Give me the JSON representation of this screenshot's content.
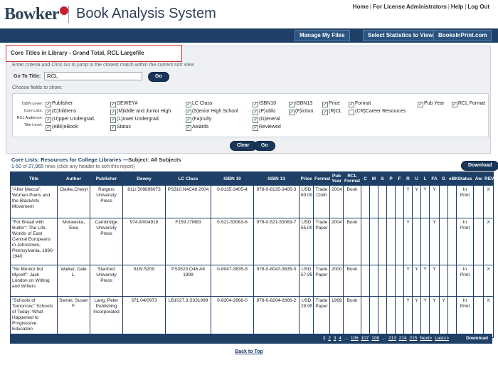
{
  "header": {
    "logo_text": "Bowker",
    "app_title": "Book Analysis System",
    "links": [
      "Home",
      "For License Administrators",
      "Help",
      "Log Out"
    ]
  },
  "nav": {
    "buttons": [
      "Manage My Files",
      "Select Statistics to View",
      "BooksInPrint.com"
    ]
  },
  "panel": {
    "title": "Core Titles in Library - Grand Total, RCL Largefile",
    "hint": "Enter criteria and Click Go to jump to the closest match within the current sort view",
    "goto_label": "Go To Title:",
    "goto_value": "RCL",
    "go_label": "Go",
    "choose_label": "Choose fields to show:",
    "clear_label": "Clear",
    "go2_label": "Go"
  },
  "fields": {
    "row_labels": [
      "ISBN Level:",
      "Core Lists:",
      "RCL Audience:",
      "Title Level:"
    ],
    "checkboxes": [
      {
        "label": "Publisher",
        "checked": true
      },
      {
        "label": "DEWEY#",
        "checked": true
      },
      {
        "label": "LC Class",
        "checked": true
      },
      {
        "label": "ISBN10",
        "checked": true
      },
      {
        "label": "ISBN13",
        "checked": true
      },
      {
        "label": "Price",
        "checked": true
      },
      {
        "label": "Format",
        "checked": true
      },
      {
        "label": "Pub Year",
        "checked": true
      },
      {
        "label": "RCL Format",
        "checked": true
      },
      {
        "label": "(C)hildrens",
        "checked": true
      },
      {
        "label": "(M)iddle and Junior High",
        "checked": true
      },
      {
        "label": "(S)enior High School",
        "checked": true
      },
      {
        "label": "(P)ublic",
        "checked": true
      },
      {
        "label": "(F)iction",
        "checked": true
      },
      {
        "label": "(R)CL",
        "checked": true
      },
      {
        "label": "(CR)Career Resources",
        "checked": false
      },
      {
        "label": "(U)pper Undergrad.",
        "checked": true
      },
      {
        "label": "(L)ower Undergrad.",
        "checked": true
      },
      {
        "label": "(Fa)culty",
        "checked": true
      },
      {
        "label": "(G)eneral",
        "checked": true
      },
      {
        "label": "(eBk)eBook",
        "checked": true
      },
      {
        "label": "Status",
        "checked": true
      },
      {
        "label": "Awards",
        "checked": true
      },
      {
        "label": "Reviewed",
        "checked": true
      }
    ]
  },
  "results": {
    "heading_link": "Core Lists: Resources for College Libraries",
    "heading_rest": " —Subject: All Subjects",
    "range": "1-50",
    "of": " of ",
    "total": "27,865",
    "rows_note": " rows (click any header to sort this report)",
    "download_label": "Download",
    "columns": [
      "Title",
      "Author",
      "Publisher",
      "Dewey",
      "LC Class",
      "ISBN 10",
      "ISBN 13",
      "Price",
      "Format",
      "Pub Year",
      "RCL Format",
      "C",
      "M",
      "S",
      "P",
      "F",
      "R",
      "U",
      "L",
      "FA",
      "G",
      "eBK",
      "Status",
      "Aw",
      "REV"
    ],
    "rows": [
      [
        "\"After Mecca\": Women Poets and the BlackArts Movement",
        "Clarke,Cheryl",
        "Rutgers University Press",
        "811/.509896073",
        "PS310.N4C48 2004",
        "0-8135-3405-4",
        "978-0-8135-3405-3",
        "USD 60.00",
        "Trade Cloth",
        "2004",
        "Book",
        "",
        "",
        "",
        "",
        "",
        "Y",
        "Y",
        "Y",
        "Y",
        "",
        "",
        "In Print",
        "",
        "X"
      ],
      [
        "\"For Bread with Butter\": The Life-Worlds of East Central Europeans in Johnstown, Pennsylvania, 1890-1940",
        "Morawska, Ewa",
        "Cambridge University Press",
        "974.8/004918",
        "F159.J7M83",
        "0-521-53063-6",
        "978-0-521-53063-7",
        "USD 55.00",
        "Trade Paper",
        "2004",
        "Book",
        "",
        "",
        "",
        "",
        "",
        "Y",
        "",
        "",
        "Y",
        "",
        "",
        "In Print",
        "",
        "X"
      ],
      [
        "\"No Mentor but Myself\": Jack London on Writing and Writers",
        "Walker, Dale L.",
        "Stanford University Press",
        "818/.5209",
        "PS3523.O46.A6 1999",
        "0-8047-3635-9",
        "978-0-8047-3635-0",
        "USD 57.95",
        "Trade Paper",
        "2000",
        "Book",
        "",
        "",
        "",
        "",
        "",
        "Y",
        "Y",
        "Y",
        "Y",
        "",
        "",
        "In Print",
        "",
        "X"
      ],
      [
        "\"Schools of Tomorrow,\" Schools of Today: What Happened to Progressive Education",
        "Semel, Susan F.",
        "Lang, Peter Publishing Incorporated",
        "371.04/0973",
        "LB1027.3.S331999",
        "0-8204-2666-0",
        "978-0-8204-2666-2",
        "USD 29.95",
        "Trade Paper",
        "1999",
        "Book",
        "",
        "",
        "",
        "",
        "",
        "Y",
        "Y",
        "Y",
        "Y",
        "Y",
        "",
        "In Print",
        "",
        "X"
      ]
    ],
    "pager": [
      "1",
      "2",
      "3",
      "4",
      "...",
      "106",
      "107",
      "108",
      "...",
      "213",
      "214",
      "215",
      "Next>",
      "Last>>"
    ],
    "footer_download": "Download",
    "back_to_top": "Back to Top"
  }
}
